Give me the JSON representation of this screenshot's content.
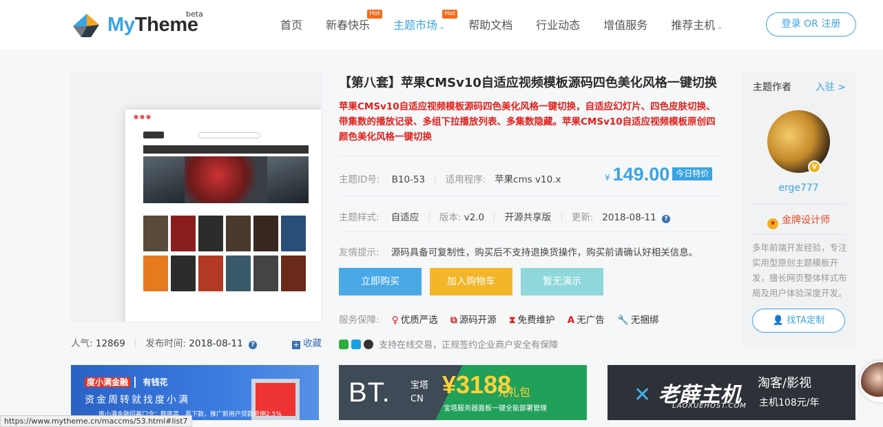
{
  "header": {
    "logo_my": "My",
    "logo_theme": "Theme",
    "logo_beta": "beta",
    "nav": [
      {
        "label": "首页"
      },
      {
        "label": "新春快乐",
        "badge": "Hot"
      },
      {
        "label": "主题市场",
        "badge": "Hot",
        "caret": "⌄"
      },
      {
        "label": "帮助文档"
      },
      {
        "label": "行业动态"
      },
      {
        "label": "增值服务"
      },
      {
        "label": "推荐主机",
        "caret": "⌄"
      }
    ],
    "login": "登录 OR 注册"
  },
  "product": {
    "title": "【第八套】苹果CMSv10自适应视频模板源码四色美化风格一键切换",
    "description": "苹果CMSv10自适应视频模板源码四色美化风格一键切换，自适应幻灯片、四色皮肤切换、带集数的播放记录、多组下拉播放列表、多集数隐藏。苹果CMSv10自适应视频模板原创四颜色美化风格一键切换",
    "id_label": "主题ID号:",
    "id_value": "B10-53",
    "program_label": "适用程序:",
    "program_value": "苹果cms v10.x",
    "price_symbol": "¥",
    "price": "149.00",
    "price_tag": "今日特价",
    "style_label": "主题样式:",
    "style_value": "自适应",
    "version_label": "版本:",
    "version_value": "v2.0",
    "license": "开源共享版",
    "updated_label": "更新:",
    "updated_value": "2018-08-11",
    "tip_label": "友情提示:",
    "tip_value": "源码具备可复制性，购买后不支持退换货操作，购买前请确认好相关信息。",
    "buy": "立即购买",
    "cart": "加入购物车",
    "demo": "暂无演示",
    "service_label": "服务保障:",
    "services": [
      "优质严选",
      "源码开源",
      "免费维护",
      "无广告",
      "无捆绑"
    ],
    "trust": "支持在线交易，正规签约企业商户安全有保障"
  },
  "stats": {
    "popularity_label": "人气:",
    "popularity_value": "12869",
    "publish_label": "发布时间:",
    "publish_value": "2018-08-11",
    "favorite": "收藏"
  },
  "author": {
    "title": "主题作者",
    "join": "入驻 >",
    "name": "erge777",
    "level": "金牌设计师",
    "bio": "多年前端开发经验，专注实用型原创主题模板开发，擅长网页整体样式布局及用户体验深度开发。",
    "custom": "找TA定制"
  },
  "ads": {
    "ad1_brand": "度小满金融",
    "ad1_slogan": "有钱花",
    "ad1_sub": "资金周转就找度小满",
    "ad1_foot": "度小满金融招募口令：额度高　易下款，推广新用户贷款返佣2.5%",
    "ad2_bt": "BT.",
    "ad2_cn_top": "宝塔",
    "ad2_cn_bottom": "CN",
    "ad2_price": "¥3188",
    "ad2_gift": "元礼包",
    "ad2_line": "宝塔服务器面板一键全能部署管理",
    "ad3_brand": "老薛主机",
    "ad3_en": "LAOXUEHOST.COM",
    "ad3_right": "淘客/影视",
    "ad3_right2": "主机108元/年"
  },
  "statusbar": "https://www.mytheme.cn/maccms/53.html#list7",
  "colors": {
    "accent": "#3aa3e3",
    "red": "#e0201b",
    "cart": "#f3b62a",
    "demo": "#8fd7db"
  }
}
